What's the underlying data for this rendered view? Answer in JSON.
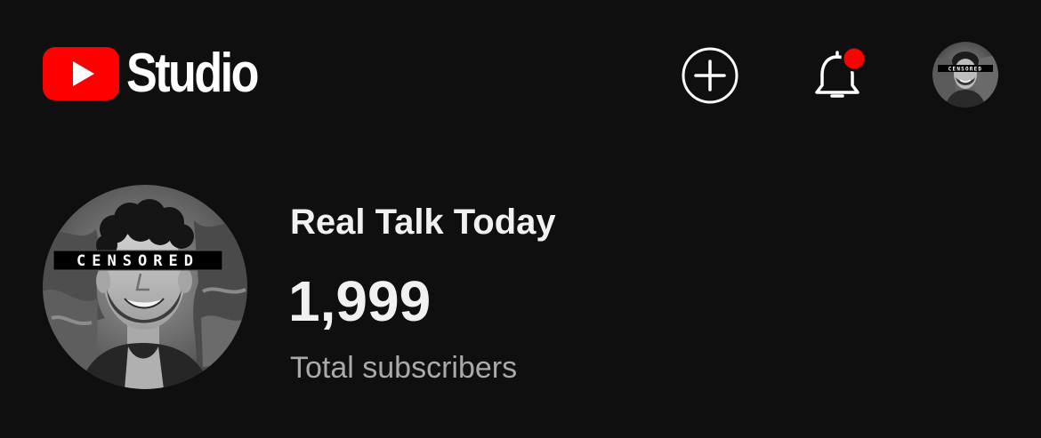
{
  "header": {
    "logo_text": "Studio",
    "create_label": "+",
    "notification_badge_color": "#ff0000",
    "icons": [
      "youtube-logo-icon",
      "create-plus-icon",
      "notification-bell-icon",
      "account-avatar"
    ]
  },
  "avatar": {
    "censor_text": "CENSORED"
  },
  "channel": {
    "name": "Real Talk Today",
    "subscriber_count": "1,999",
    "subscriber_label": "Total subscribers"
  },
  "colors": {
    "background": "#0f0f0f",
    "brand_red": "#ff0000",
    "primary_text": "#f1f1f1",
    "secondary_text": "#aaaaaa"
  }
}
